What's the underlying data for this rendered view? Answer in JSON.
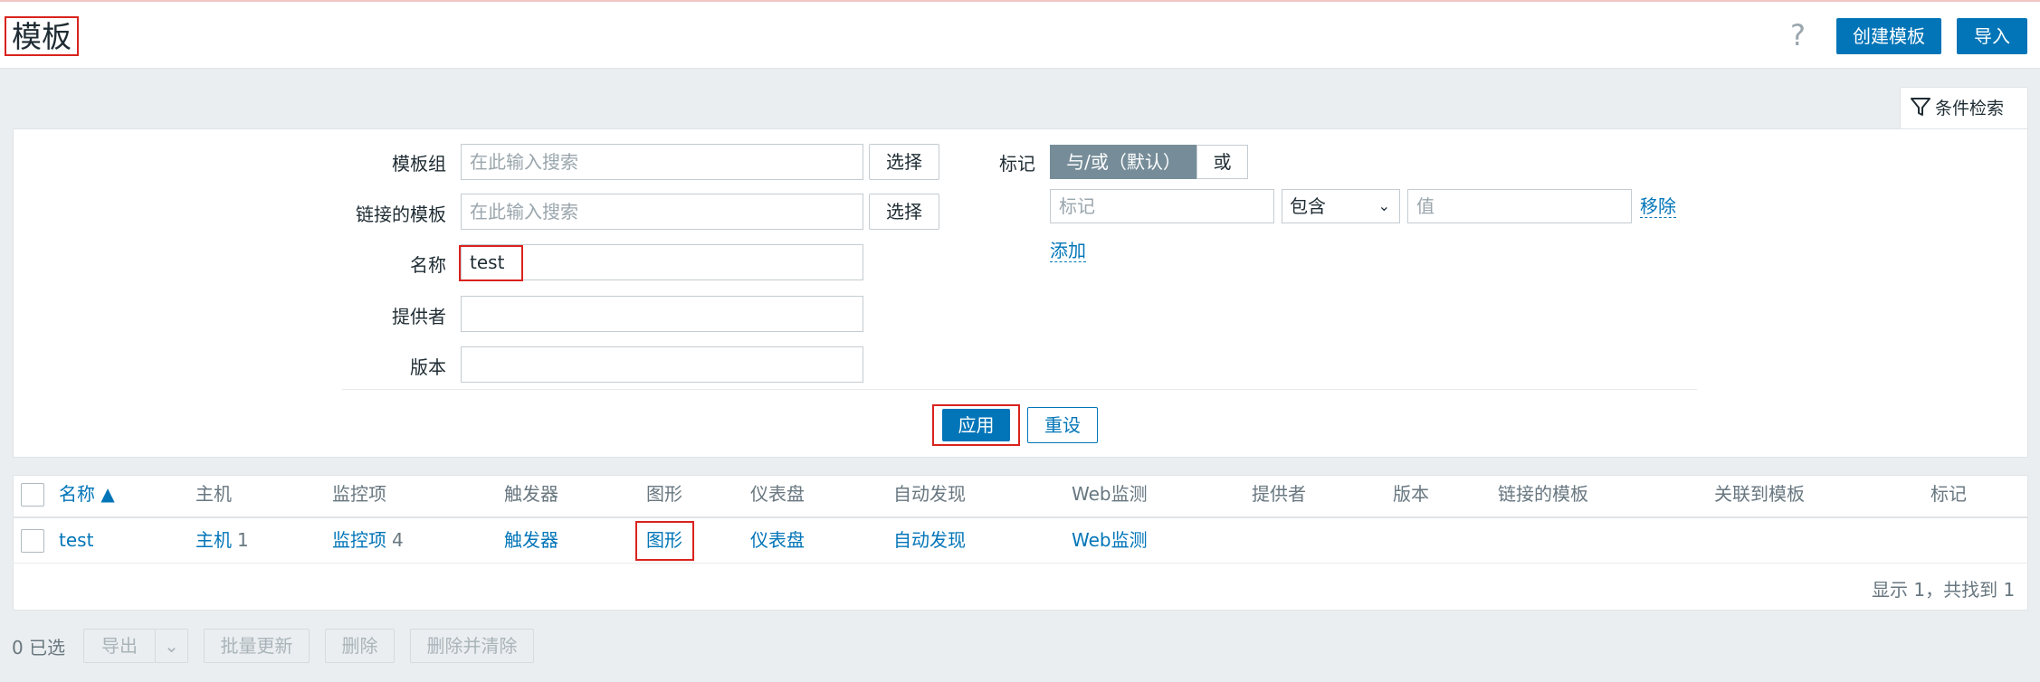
{
  "header": {
    "title": "模板",
    "help_icon": "?",
    "create_label": "创建模板",
    "import_label": "导入"
  },
  "filter": {
    "tab_label": "条件检索",
    "template_group_label": "模板组",
    "template_group_placeholder": "在此输入搜索",
    "linked_templates_label": "链接的模板",
    "linked_templates_placeholder": "在此输入搜索",
    "select_label": "选择",
    "name_label": "名称",
    "name_value": "test",
    "vendor_label": "提供者",
    "version_label": "版本",
    "tags_label": "标记",
    "tags_andor": "与/或（默认）",
    "tags_or": "或",
    "tag_placeholder": "标记",
    "operator": "包含",
    "value_placeholder": "值",
    "remove_label": "移除",
    "add_label": "添加",
    "apply_label": "应用",
    "reset_label": "重设"
  },
  "table": {
    "columns": [
      "名称 ▲",
      "主机",
      "监控项",
      "触发器",
      "图形",
      "仪表盘",
      "自动发现",
      "Web监测",
      "提供者",
      "版本",
      "链接的模板",
      "关联到模板",
      "标记"
    ],
    "rows": [
      {
        "name": "test",
        "hosts_label": "主机",
        "hosts_count": "1",
        "items_label": "监控项",
        "items_count": "4",
        "triggers": "触发器",
        "graphs": "图形",
        "dashboards": "仪表盘",
        "discovery": "自动发现",
        "web": "Web监测"
      }
    ],
    "footer": "显示 1，共找到 1"
  },
  "actions": {
    "selected": "0 已选",
    "export": "导出",
    "mass_update": "批量更新",
    "delete": "删除",
    "delete_clear": "删除并清除"
  }
}
